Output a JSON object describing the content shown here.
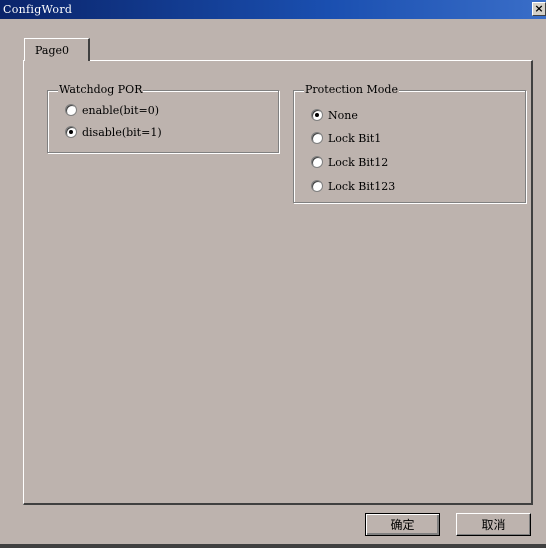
{
  "window": {
    "title": "ConfigWord",
    "close_glyph": "×"
  },
  "tabs": [
    {
      "label": "Page0",
      "selected": true
    }
  ],
  "watchdog": {
    "title": "Watchdog POR",
    "options": [
      {
        "label": "enable(bit=0)",
        "checked": false
      },
      {
        "label": "disable(bit=1)",
        "checked": true
      }
    ]
  },
  "protection": {
    "title": "Protection Mode",
    "options": [
      {
        "label": "None",
        "checked": true
      },
      {
        "label": "Lock Bit1",
        "checked": false
      },
      {
        "label": "Lock Bit12",
        "checked": false
      },
      {
        "label": "Lock Bit123",
        "checked": false
      }
    ]
  },
  "buttons": {
    "ok_label": "确定",
    "cancel_label": "取消"
  },
  "colors": {
    "dialog_bg": "#bdb3ae",
    "titlebar": "#0a246a"
  }
}
